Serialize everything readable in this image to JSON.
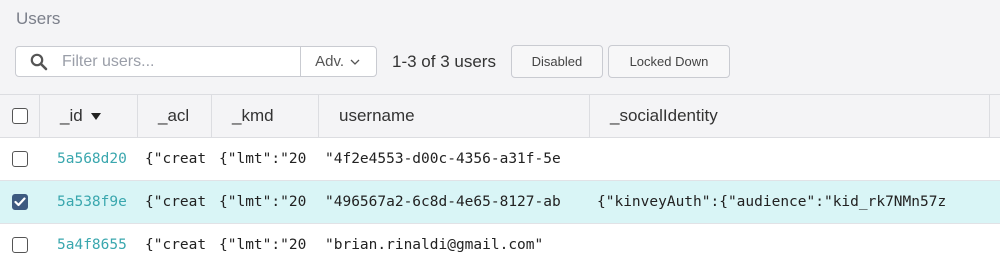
{
  "panel": {
    "title": "Users"
  },
  "toolbar": {
    "search_placeholder": "Filter users...",
    "adv_label": "Adv.",
    "count_text": "1-3 of 3 users",
    "disabled_label": "Disabled",
    "locked_label": "Locked Down"
  },
  "table": {
    "headers": {
      "id": "_id",
      "acl": "_acl",
      "kmd": "_kmd",
      "username": "username",
      "social": "_socialIdentity"
    },
    "rows": [
      {
        "selected": false,
        "id": "5a568d20",
        "acl": "{\"creat",
        "kmd": "{\"lmt\":\"20",
        "username": "\"4f2e4553-d00c-4356-a31f-5e",
        "social": ""
      },
      {
        "selected": true,
        "id": "5a538f9e",
        "acl": "{\"creat",
        "kmd": "{\"lmt\":\"20",
        "username": "\"496567a2-6c8d-4e65-8127-ab",
        "social": "{\"kinveyAuth\":{\"audience\":\"kid_rk7NMn57z"
      },
      {
        "selected": false,
        "id": "5a4f8655",
        "acl": "{\"creat",
        "kmd": "{\"lmt\":\"20",
        "username": "\"brian.rinaldi@gmail.com\"",
        "social": ""
      }
    ]
  },
  "colors": {
    "id_link": "#3aa7ae",
    "selected_row": "#d9f5f6",
    "checkbox_checked": "#3d5a80"
  },
  "icons": {
    "search": "search-icon",
    "adv": "chevron-down-icon",
    "sort": "sort-descending-icon",
    "check": "checkmark-icon"
  }
}
